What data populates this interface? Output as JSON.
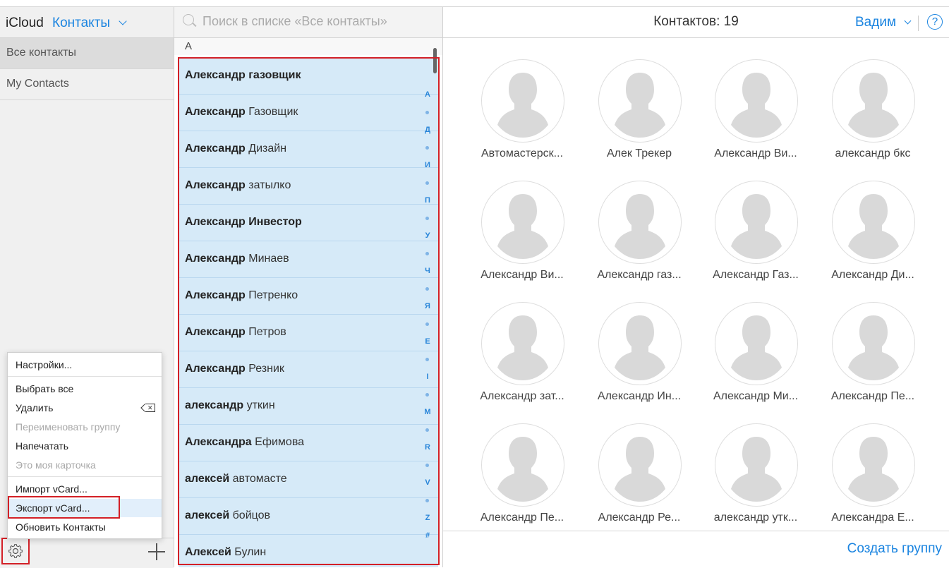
{
  "app": {
    "brand": "iCloud",
    "name": "Контакты"
  },
  "sidebar": {
    "groups": [
      {
        "label": "Все контакты",
        "active": true
      },
      {
        "label": "My Contacts",
        "active": false
      }
    ]
  },
  "menu": {
    "items": [
      {
        "label": "Настройки...",
        "disabled": false
      },
      {
        "label": "Выбрать все",
        "disabled": false
      },
      {
        "label": "Удалить",
        "disabled": false,
        "icon": "delete-key-icon"
      },
      {
        "label": "Переименовать группу",
        "disabled": true
      },
      {
        "label": "Напечатать",
        "disabled": false
      },
      {
        "label": "Это моя карточка",
        "disabled": true
      },
      {
        "label": "Импорт vCard...",
        "disabled": false
      },
      {
        "label": "Экспорт vCard...",
        "disabled": false,
        "highlighted": true
      },
      {
        "label": "Обновить Контакты",
        "disabled": false
      }
    ]
  },
  "search": {
    "placeholder": "Поиск в списке «Все контакты»"
  },
  "list": {
    "section_letter": "А",
    "contacts": [
      {
        "first": "Александр",
        "last": "газовщик"
      },
      {
        "first": "Александр",
        "last": "Газовщик"
      },
      {
        "first": "Александр",
        "last": "Дизайн"
      },
      {
        "first": "Александр",
        "last": "затылко"
      },
      {
        "first": "Александр",
        "last": "Инвестор"
      },
      {
        "first": "Александр",
        "last": "Минаев"
      },
      {
        "first": "Александр",
        "last": "Петренко"
      },
      {
        "first": "Александр",
        "last": "Петров"
      },
      {
        "first": "Александр",
        "last": "Резник"
      },
      {
        "first": "александр",
        "last": "уткин"
      },
      {
        "first": "Александра",
        "last": "Ефимова"
      },
      {
        "first": "алексей",
        "last": "автомасте"
      },
      {
        "first": "алексей",
        "last": "бойцов"
      },
      {
        "first": "Алексей",
        "last": "Булин"
      }
    ],
    "index_letters": [
      "А",
      "Д",
      "И",
      "П",
      "У",
      "Ч",
      "Я",
      "E",
      "I",
      "M",
      "R",
      "V",
      "Z",
      "#"
    ]
  },
  "right": {
    "count_label": "Контактов: 19",
    "user_name": "Вадим",
    "help_label": "?",
    "cards": [
      "Автомастерск...",
      "Алек Трекер",
      "Александр Ви...",
      "александр бкс",
      "Александр Ви...",
      "Александр газ...",
      "Александр Газ...",
      "Александр Ди...",
      "Александр зат...",
      "Александр Ин...",
      "Александр Ми...",
      "Александр Пе...",
      "Александр Пе...",
      "Александр Ре...",
      "александр утк...",
      "Александра Е..."
    ],
    "create_group_label": "Создать группу"
  },
  "colors": {
    "accent": "#1a84e0",
    "selection": "#d6eaf8",
    "annotation": "#d32027"
  }
}
